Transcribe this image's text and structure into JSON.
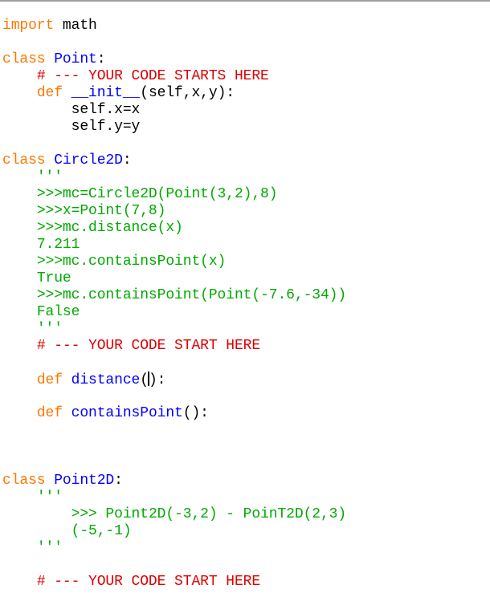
{
  "editor": {
    "lines": [
      [
        {
          "t": "kw",
          "v": "import"
        },
        {
          "t": "plain",
          "v": " math"
        }
      ],
      [],
      [
        {
          "t": "kw",
          "v": "class"
        },
        {
          "t": "plain",
          "v": " "
        },
        {
          "t": "def",
          "v": "Point"
        },
        {
          "t": "plain",
          "v": ":"
        }
      ],
      [
        {
          "t": "plain",
          "v": "    "
        },
        {
          "t": "cmt",
          "v": "# --- YOUR CODE STARTS HERE"
        }
      ],
      [
        {
          "t": "plain",
          "v": "    "
        },
        {
          "t": "kw",
          "v": "def"
        },
        {
          "t": "plain",
          "v": " "
        },
        {
          "t": "def",
          "v": "__init__"
        },
        {
          "t": "plain",
          "v": "(self,x,y):"
        }
      ],
      [
        {
          "t": "plain",
          "v": "        self.x=x"
        }
      ],
      [
        {
          "t": "plain",
          "v": "        self.y=y"
        }
      ],
      [],
      [
        {
          "t": "kw",
          "v": "class"
        },
        {
          "t": "plain",
          "v": " "
        },
        {
          "t": "def",
          "v": "Circle2D"
        },
        {
          "t": "plain",
          "v": ":"
        }
      ],
      [
        {
          "t": "plain",
          "v": "    "
        },
        {
          "t": "str",
          "v": "'''"
        }
      ],
      [
        {
          "t": "plain",
          "v": "    "
        },
        {
          "t": "str",
          "v": ">>>mc=Circle2D(Point(3,2),8)"
        }
      ],
      [
        {
          "t": "plain",
          "v": "    "
        },
        {
          "t": "str",
          "v": ">>>x=Point(7,8)"
        }
      ],
      [
        {
          "t": "plain",
          "v": "    "
        },
        {
          "t": "str",
          "v": ">>>mc.distance(x)"
        }
      ],
      [
        {
          "t": "plain",
          "v": "    "
        },
        {
          "t": "str",
          "v": "7.211"
        }
      ],
      [
        {
          "t": "plain",
          "v": "    "
        },
        {
          "t": "str",
          "v": ">>>mc.containsPoint(x)"
        }
      ],
      [
        {
          "t": "plain",
          "v": "    "
        },
        {
          "t": "str",
          "v": "True"
        }
      ],
      [
        {
          "t": "plain",
          "v": "    "
        },
        {
          "t": "str",
          "v": ">>>mc.containsPoint(Point(-7.6,-34))"
        }
      ],
      [
        {
          "t": "plain",
          "v": "    "
        },
        {
          "t": "str",
          "v": "False"
        }
      ],
      [
        {
          "t": "plain",
          "v": "    "
        },
        {
          "t": "str",
          "v": "'''"
        }
      ],
      [
        {
          "t": "plain",
          "v": "    "
        },
        {
          "t": "cmt",
          "v": "# --- YOUR CODE START HERE"
        }
      ],
      [],
      [
        {
          "t": "plain",
          "v": "    "
        },
        {
          "t": "kw",
          "v": "def"
        },
        {
          "t": "plain",
          "v": " "
        },
        {
          "t": "def",
          "v": "distance"
        },
        {
          "t": "plain",
          "v": "("
        },
        {
          "t": "cursor",
          "v": ""
        },
        {
          "t": "plain",
          "v": "):"
        }
      ],
      [],
      [
        {
          "t": "plain",
          "v": "    "
        },
        {
          "t": "kw",
          "v": "def"
        },
        {
          "t": "plain",
          "v": " "
        },
        {
          "t": "def",
          "v": "containsPoint"
        },
        {
          "t": "plain",
          "v": "():"
        }
      ],
      [],
      [],
      [],
      [
        {
          "t": "kw",
          "v": "class"
        },
        {
          "t": "plain",
          "v": " "
        },
        {
          "t": "def",
          "v": "Point2D"
        },
        {
          "t": "plain",
          "v": ":"
        }
      ],
      [
        {
          "t": "plain",
          "v": "    "
        },
        {
          "t": "str",
          "v": "'''"
        }
      ],
      [
        {
          "t": "plain",
          "v": "        "
        },
        {
          "t": "str",
          "v": ">>> Point2D(-3,2) - PoinT2D(2,3)"
        }
      ],
      [
        {
          "t": "plain",
          "v": "        "
        },
        {
          "t": "str",
          "v": "(-5,-1)"
        }
      ],
      [
        {
          "t": "plain",
          "v": "    "
        },
        {
          "t": "str",
          "v": "'''"
        }
      ],
      [],
      [
        {
          "t": "plain",
          "v": "    "
        },
        {
          "t": "cmt",
          "v": "# --- YOUR CODE START HERE"
        }
      ]
    ]
  }
}
